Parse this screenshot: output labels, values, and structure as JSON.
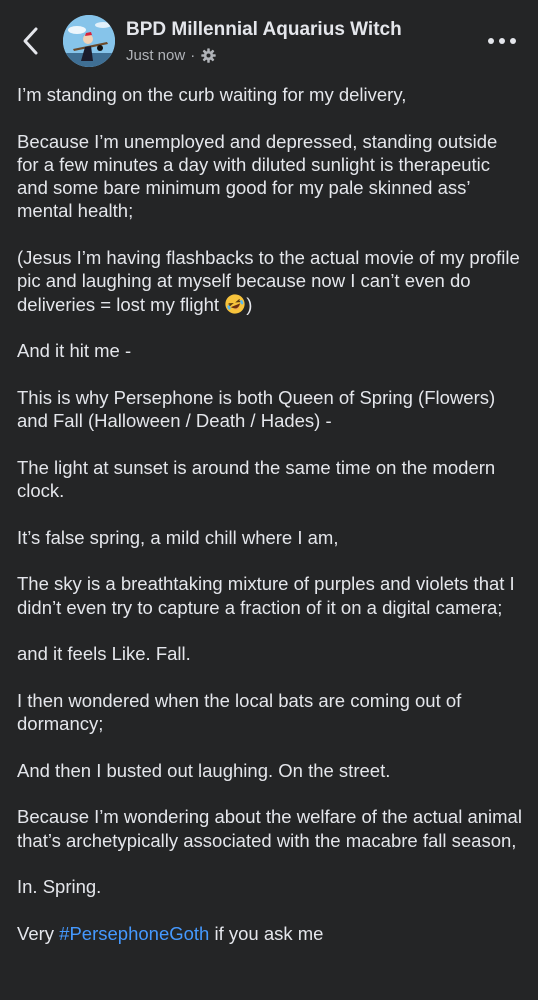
{
  "header": {
    "author_name": "BPD Millennial Aquarius Witch",
    "timestamp": "Just now",
    "separator": "·",
    "audience_icon": "settings-gear-icon",
    "back_icon": "chevron-left-icon",
    "more_icon": "more-dots-icon"
  },
  "post": {
    "paragraphs": [
      "I’m standing on the curb waiting for my delivery,",
      "Because I’m unemployed and depressed, standing outside for a few minutes a day with diluted sunlight is therapeutic and some bare minimum good for my pale skinned ass’ mental health;",
      "(Jesus I’m having flashbacks to the actual movie of my profile pic and laughing at myself because now I can’t even do deliveries = lost my flight ",
      "And it hit me -",
      "This is why Persephone is both Queen of Spring (Flowers) and Fall (Halloween / Death / Hades) -",
      "The light at sunset is around the same time on the modern clock.",
      "It’s false spring, a mild chill where I am,",
      "The sky is a breathtaking mixture of purples and violets that I didn’t even try to capture a fraction of it on a digital camera;",
      "and it feels Like. Fall.",
      "I then wondered when the local bats are coming out of dormancy;",
      "And then I busted out laughing. On the street.",
      "Because I’m wondering about the welfare of the actual animal that’s archetypically associated with the macabre fall season,",
      "In. Spring."
    ],
    "paragraph_3_close": ")",
    "emoji_name": "rolling-on-floor-laughing-emoji",
    "last_line_prefix": "Very ",
    "hashtag": "#PersephoneGoth",
    "last_line_suffix": " if you ask me"
  },
  "colors": {
    "background": "#242526",
    "text": "#e4e6eb",
    "secondary_text": "#b0b3b8",
    "hashtag": "#4599ff"
  }
}
